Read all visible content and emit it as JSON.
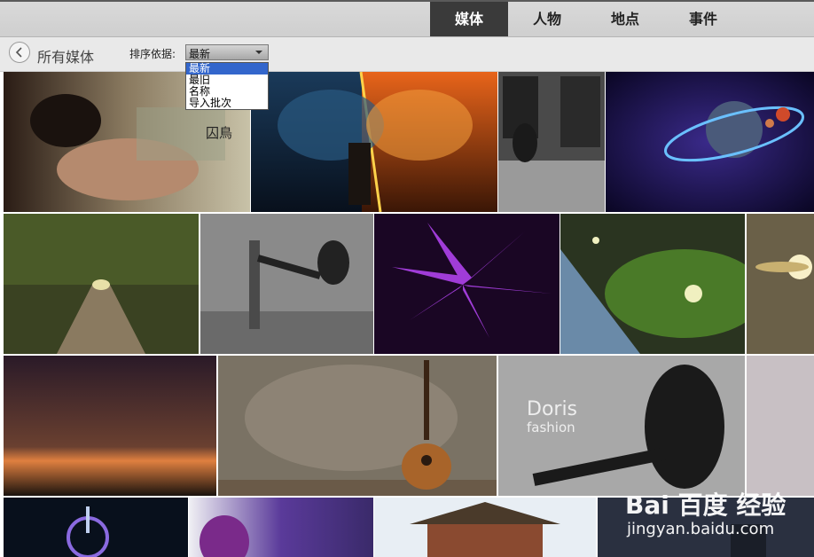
{
  "tabs": [
    {
      "label": "媒体",
      "active": true
    },
    {
      "label": "人物",
      "active": false
    },
    {
      "label": "地点",
      "active": false
    },
    {
      "label": "事件",
      "active": false
    }
  ],
  "breadcrumb": {
    "label": "所有媒体"
  },
  "sort": {
    "label": "排序依据:",
    "selected": "最新",
    "options": [
      "最新",
      "最旧",
      "名称",
      "导入批次"
    ]
  },
  "tiles": {
    "woman_text": "囚鳥",
    "doris_title": "Doris",
    "doris_sub": "fashion"
  },
  "watermark": {
    "logo": "Bai 百度 经验",
    "url": "jingyan.baidu.com"
  },
  "colors": {
    "active_tab": "#3a3a3a",
    "dropdown_highlight": "#3366cc"
  }
}
